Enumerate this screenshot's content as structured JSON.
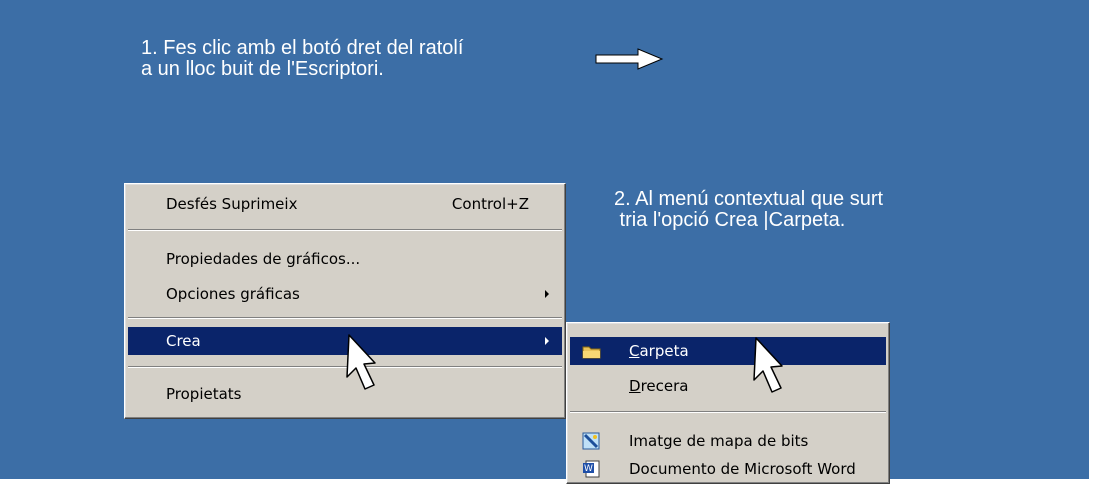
{
  "instructions": {
    "step1": "1. Fes clic amb el botó dret del ratolí\na un lloc buit de l'Escriptori.",
    "step2": "2. Al menú contextual que surt\n tria l'opció Crea |Carpeta."
  },
  "context_menu": {
    "items": [
      {
        "label": "Desfés Suprimeix",
        "shortcut": "Control+Z"
      },
      {
        "label": "Propiedades de gráficos..."
      },
      {
        "label": "Opciones gráficas",
        "submenu": true
      },
      {
        "label": "Crea",
        "submenu": true,
        "highlighted": true
      },
      {
        "label": "Propietats"
      }
    ]
  },
  "sub_menu": {
    "items": [
      {
        "mnemonic": "C",
        "rest": "arpeta",
        "icon": "folder-icon",
        "highlighted": true
      },
      {
        "mnemonic": "D",
        "rest": "recera"
      },
      {
        "label": "Imatge de mapa de bits",
        "icon": "bitmap-image-icon"
      },
      {
        "label": "Documento de Microsoft Word",
        "icon": "word-document-icon"
      }
    ]
  },
  "colors": {
    "desktop": "#3c6ea6",
    "menu": "#d4d0c8",
    "highlight": "#0a246a"
  }
}
